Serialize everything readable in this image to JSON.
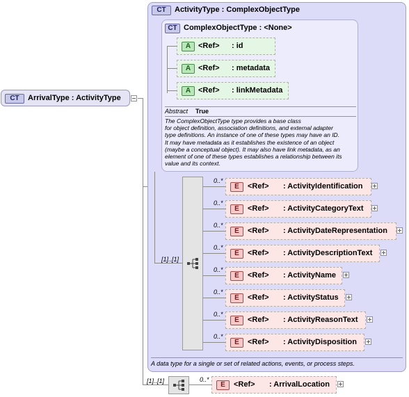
{
  "root": {
    "badge": "CT",
    "name": "ArrivalType",
    "sep": ":",
    "base": "ActivityType"
  },
  "activity_type": {
    "badge": "CT",
    "name": "ActivityType",
    "sep": ":",
    "base": "ComplexObjectType",
    "documentation": "A data type for a single or set of related actions, events, or process steps."
  },
  "complex_object_type": {
    "badge": "CT",
    "name": "ComplexObjectType",
    "sep": ":",
    "base": "<None>",
    "abstract_label": "Abstract",
    "abstract_value": "True",
    "documentation": [
      "The ComplexObjectType type provides a base class",
      "for object definition, association definitions, and external adapter",
      "type definitions. An instance of one of these types may have an ID.",
      "It may have metadata as it establishes the existence of an object",
      "(maybe a conceptual object). It may also have link metadata, as an",
      "element of one of these types establishes a relationship between its",
      "value and its context."
    ],
    "attributes": [
      {
        "badge": "A",
        "ref": "<Ref>",
        "name": ": id"
      },
      {
        "badge": "A",
        "ref": "<Ref>",
        "name": ": metadata"
      },
      {
        "badge": "A",
        "ref": "<Ref>",
        "name": ": linkMetadata"
      }
    ]
  },
  "activity_sequence": {
    "multiplicity": "[1]..[1]",
    "elements": [
      {
        "mult": "0..*",
        "badge": "E",
        "ref": "<Ref>",
        "name": ": ActivityIdentification"
      },
      {
        "mult": "0..*",
        "badge": "E",
        "ref": "<Ref>",
        "name": ": ActivityCategoryText"
      },
      {
        "mult": "0..*",
        "badge": "E",
        "ref": "<Ref>",
        "name": ": ActivityDateRepresentation"
      },
      {
        "mult": "0..*",
        "badge": "E",
        "ref": "<Ref>",
        "name": ": ActivityDescriptionText"
      },
      {
        "mult": "0..*",
        "badge": "E",
        "ref": "<Ref>",
        "name": ": ActivityName"
      },
      {
        "mult": "0..*",
        "badge": "E",
        "ref": "<Ref>",
        "name": ": ActivityStatus"
      },
      {
        "mult": "0..*",
        "badge": "E",
        "ref": "<Ref>",
        "name": ": ActivityReasonText"
      },
      {
        "mult": "0..*",
        "badge": "E",
        "ref": "<Ref>",
        "name": ": ActivityDisposition"
      }
    ]
  },
  "arrival_sequence": {
    "multiplicity": "[1]..[1]",
    "element": {
      "mult": "0..*",
      "badge": "E",
      "ref": "<Ref>",
      "name": ": ArrivalLocation"
    }
  },
  "colors": {
    "ct_panel": "#dcdcf8",
    "element_fill": "#fde6e6",
    "attribute_fill": "#e4f6e4"
  }
}
